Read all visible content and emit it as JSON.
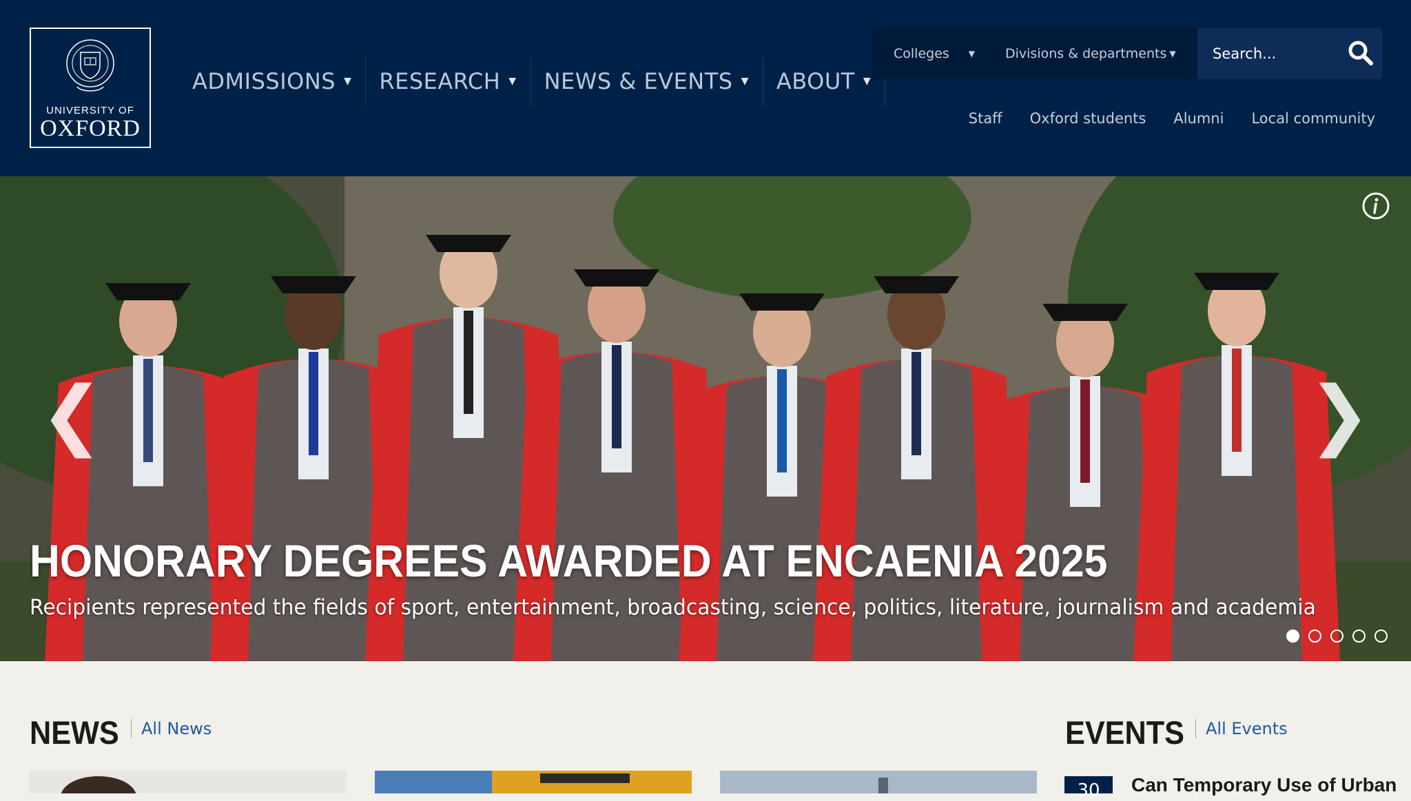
{
  "logo": {
    "line1": "UNIVERSITY OF",
    "line2": "OXFORD"
  },
  "main_nav": [
    {
      "label": "ADMISSIONS"
    },
    {
      "label": "RESEARCH"
    },
    {
      "label": "NEWS & EVENTS"
    },
    {
      "label": "ABOUT"
    }
  ],
  "utility_nav": {
    "colleges": "Colleges",
    "divisions": "Divisions & departments"
  },
  "search": {
    "placeholder": "Search..."
  },
  "audience_links": [
    "Staff",
    "Oxford students",
    "Alumni",
    "Local community"
  ],
  "hero": {
    "title": "HONORARY DEGREES AWARDED AT ENCAENIA 2025",
    "subtitle": "Recipients represented the fields of sport, entertainment, broadcasting, science, politics, literature, journalism and academia",
    "prev_arrow": "❮",
    "next_arrow": "❯",
    "slide_count": 5,
    "active_slide": 1
  },
  "news": {
    "heading": "NEWS",
    "link": "All News"
  },
  "events": {
    "heading": "EVENTS",
    "link": "All Events",
    "first_date": "30",
    "first_title": "Can Temporary Use of Urban"
  },
  "colors": {
    "navy": "#002147",
    "accent_link": "#1c5a9b",
    "background": "#f2f0eb"
  }
}
